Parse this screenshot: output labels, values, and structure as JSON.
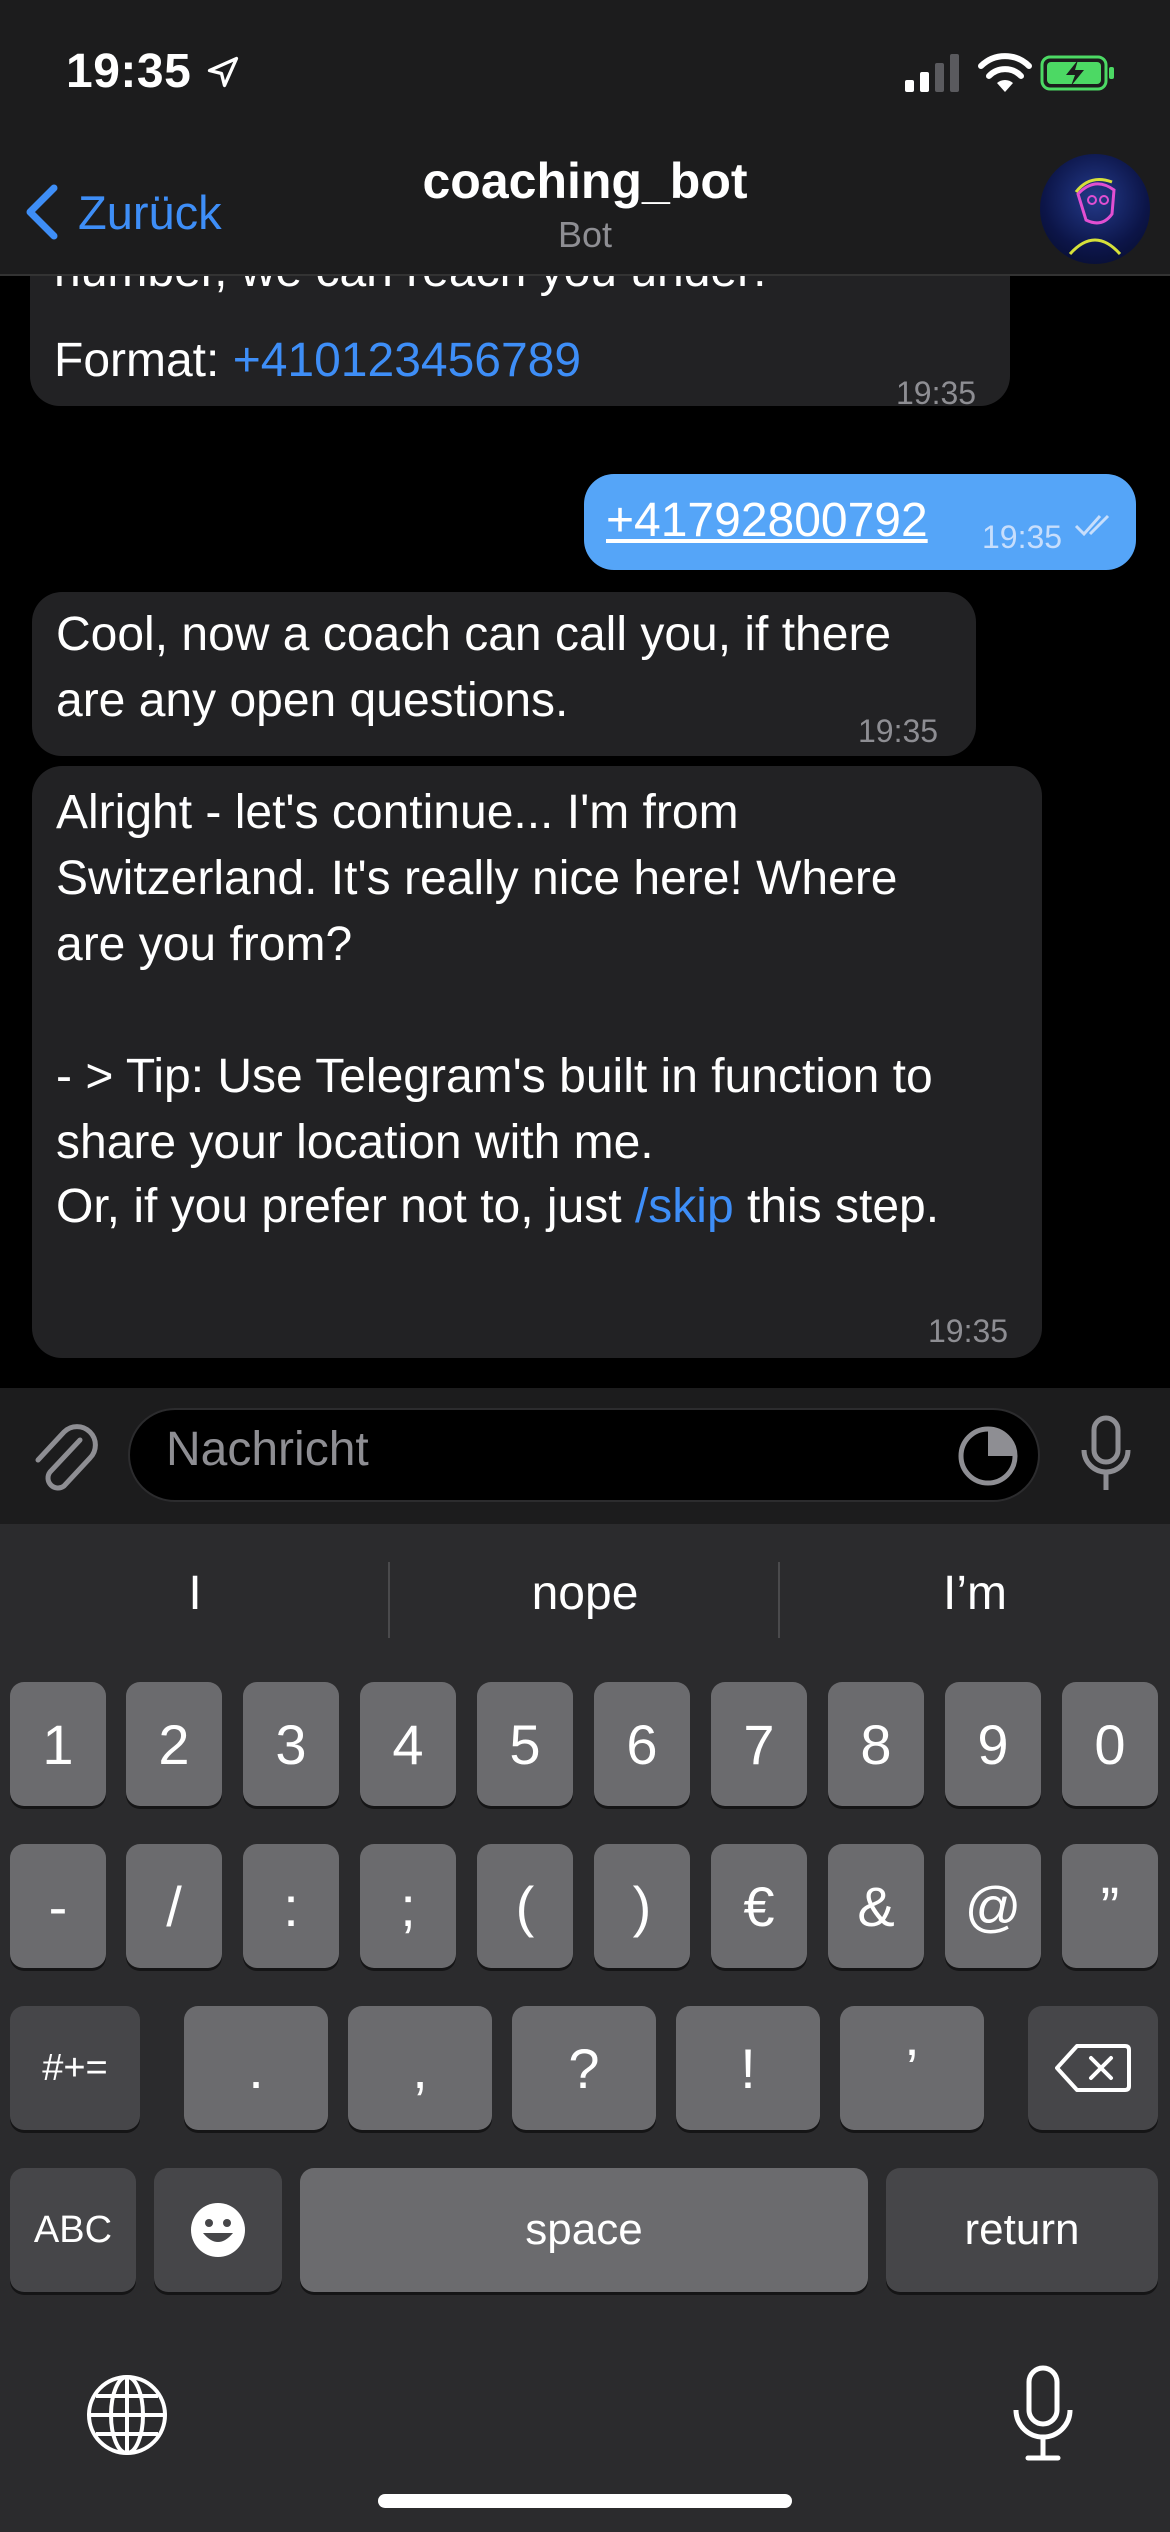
{
  "status": {
    "time": "19:35"
  },
  "nav": {
    "back_label": "Zurück",
    "title": "coaching_bot",
    "subtitle": "Bot"
  },
  "messages": [
    {
      "from": "bot",
      "text_partial": "number, we can reach you under:",
      "format_label": "Format: ",
      "format_value": "+410123456789",
      "time": "19:35"
    },
    {
      "from": "user",
      "text": "+41792800792",
      "time": "19:35"
    },
    {
      "from": "bot",
      "text": "Cool, now a coach can call you, if there\nare any open questions.",
      "time": "19:35"
    },
    {
      "from": "bot",
      "text": "Alright - let's continue... I'm from\nSwitzerland. It's really nice here! Where\nare you from?\n\n- > Tip: Use Telegram's built in function to\nshare your location with me.\n\n",
      "skip_prefix": "Or, if you prefer not to, just ",
      "skip_cmd": "/skip",
      "skip_suffix": " this step.",
      "time": "19:35"
    }
  ],
  "input": {
    "placeholder": "Nachricht"
  },
  "keyboard": {
    "suggestions": [
      "I",
      "nope",
      "I’m"
    ],
    "row1": [
      "1",
      "2",
      "3",
      "4",
      "5",
      "6",
      "7",
      "8",
      "9",
      "0"
    ],
    "row2": [
      "-",
      "/",
      ":",
      ";",
      "(",
      ")",
      "€",
      "&",
      "@",
      "”"
    ],
    "row3": [
      "#+=",
      ".",
      ",",
      "?",
      "!",
      "’"
    ],
    "abc": "ABC",
    "space": "space",
    "return": "return"
  },
  "icons": [
    "location-arrow-icon",
    "signal-icon",
    "wifi-icon",
    "battery-charging-icon",
    "back-chevron-icon",
    "bot-avatar",
    "paperclip-icon",
    "sticker-icon",
    "microphone-icon",
    "backspace-icon",
    "emoji-icon",
    "globe-icon"
  ],
  "colors": {
    "accent": "#3e8ef7",
    "outgoing_bubble": "#55a5f8",
    "incoming_bubble": "#222224"
  }
}
